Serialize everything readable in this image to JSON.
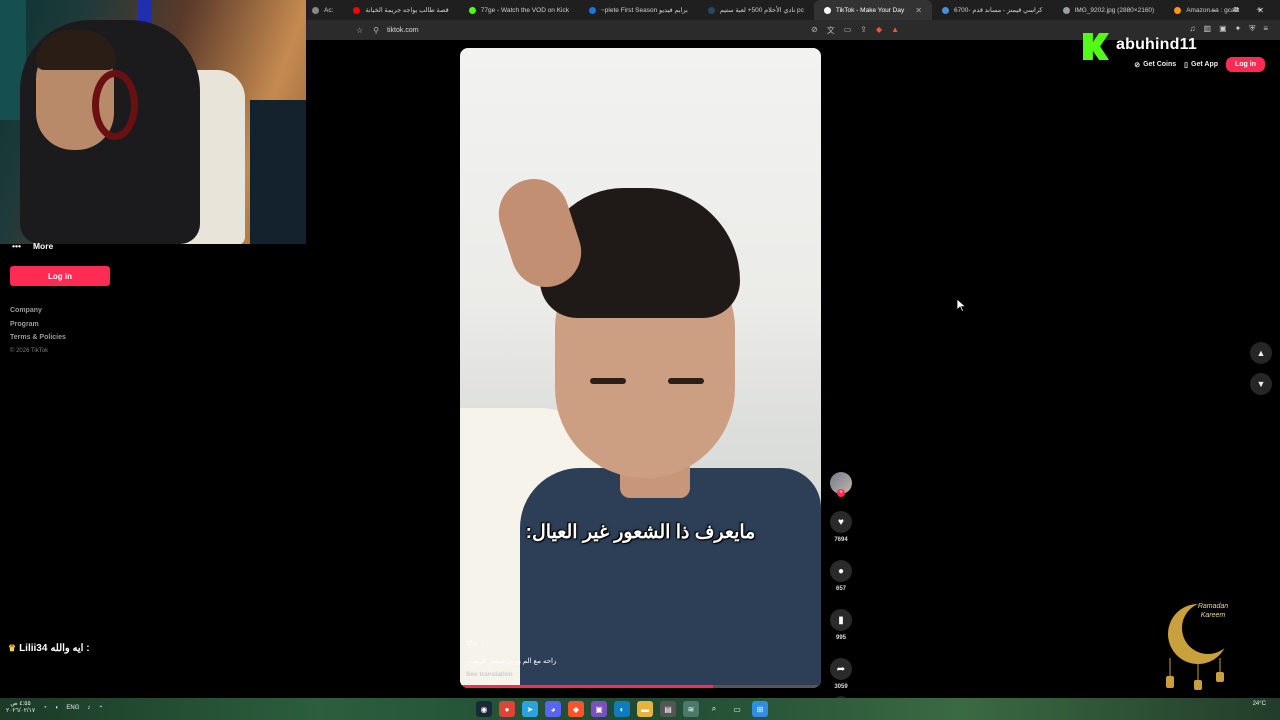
{
  "browser": {
    "tabs": [
      {
        "label": "Ac:",
        "color": "#888888"
      },
      {
        "label": "قصة طالب يواجه جريمة الخيانة",
        "color": "#ff0000"
      },
      {
        "label": "77ge - Watch the VOD on Kick",
        "color": "#53fc18"
      },
      {
        "label": "~plete First Season برايم فيديو",
        "color": "#1a73e8"
      },
      {
        "label": "نادي الأحلام 500+ لعبة ستيم pc",
        "color": "#2a475e"
      },
      {
        "label": "TikTok - Make Your Day",
        "color": "#ffffff",
        "active": true
      },
      {
        "label": "6700- كراسي قيمنز - مساند قدم",
        "color": "#4a90d9"
      },
      {
        "label": "IMG_9202.jpg (2880×2160)",
        "color": "#9aa0a6"
      },
      {
        "label": "Amazon.sa : gcalr",
        "color": "#ff9900"
      }
    ],
    "new_tab": "+",
    "url": "tiktok.com",
    "window_controls": [
      "–",
      "⧉",
      "✕"
    ]
  },
  "stream": {
    "kick_username": "abuhind11",
    "chat_user": "Lilii34",
    "chat_text": "ايه والله :",
    "ramadan_badge": "Ramadan Kareem"
  },
  "tiktok": {
    "header": {
      "get_coins": "Get Coins",
      "get_app": "Get App",
      "login": "Log in"
    },
    "sidebar": {
      "more": "More",
      "login": "Log in",
      "links": [
        "Company",
        "Program",
        "Terms & Policies"
      ],
      "copyright": "© 2026 TikTok"
    },
    "video": {
      "caption": "مايعرف ذا الشعور غير العيال:",
      "username": "q1u_i",
      "description": "راحه مع الم وربي شعور غريب .",
      "see_translation": "See translation",
      "progress": 0.7
    },
    "actions": {
      "likes": "7694",
      "comments": "657",
      "saves": "995",
      "shares": "3059"
    }
  },
  "taskbar": {
    "lang": "ENG",
    "weather": "24°C",
    "time_left": "٤:٥٥ ص",
    "date_left": "٢٠٢٦/٠٢/١٧"
  }
}
